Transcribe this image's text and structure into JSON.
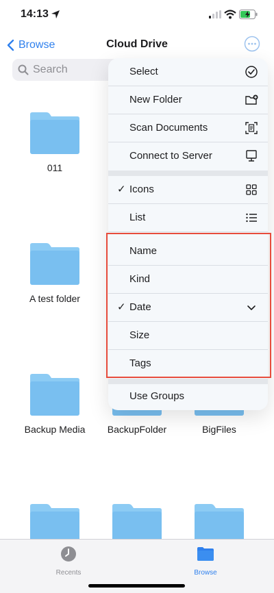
{
  "status": {
    "time": "14:13"
  },
  "nav": {
    "back_label": "Browse",
    "title": "Cloud Drive"
  },
  "search": {
    "placeholder": "Search"
  },
  "folders": [
    {
      "name": "011"
    },
    {
      "name": "A test folder"
    },
    {
      "name": "Backup Media"
    },
    {
      "name": "BackupFolder"
    },
    {
      "name": "BigFiles"
    }
  ],
  "menu": {
    "actions": [
      {
        "label": "Select",
        "icon": "checkmark-circle-icon"
      },
      {
        "label": "New Folder",
        "icon": "folder-plus-icon"
      },
      {
        "label": "Scan Documents",
        "icon": "scan-document-icon"
      },
      {
        "label": "Connect to Server",
        "icon": "monitor-icon"
      }
    ],
    "view": [
      {
        "label": "Icons",
        "checked": true,
        "check_mark": "✓",
        "icon": "grid-icon"
      },
      {
        "label": "List",
        "checked": false,
        "icon": "list-icon"
      }
    ],
    "sort": [
      {
        "label": "Name"
      },
      {
        "label": "Kind"
      },
      {
        "label": "Date",
        "checked": true,
        "check_mark": "✓",
        "icon": "chevron-down-icon"
      },
      {
        "label": "Size"
      },
      {
        "label": "Tags"
      }
    ],
    "groups": {
      "label": "Use Groups"
    }
  },
  "tabbar": {
    "recents_label": "Recents",
    "browse_label": "Browse",
    "active": "Browse",
    "active_color": "#2f80ed",
    "inactive_color": "#8e8e93"
  },
  "colors": {
    "accent": "#2f80ed",
    "folder": "#79bff0",
    "highlight_border": "#e74c3c"
  }
}
